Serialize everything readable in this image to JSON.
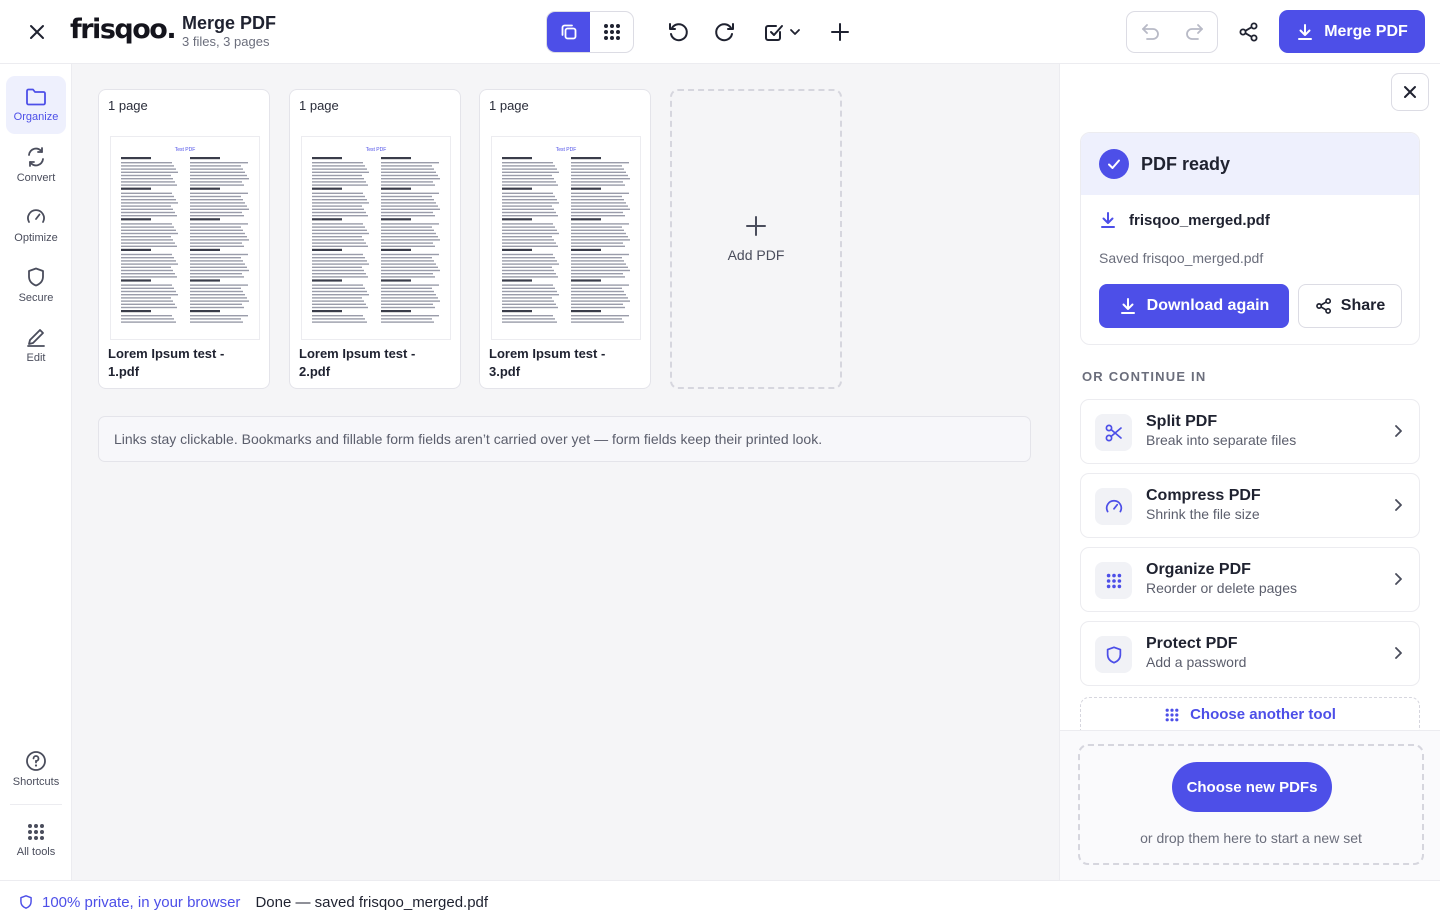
{
  "header": {
    "logo": "frisqoo.",
    "title": "Merge PDF",
    "subtitle": "3 files, 3 pages",
    "merge_button": "Merge PDF"
  },
  "rail": {
    "items": [
      {
        "label": "Organize"
      },
      {
        "label": "Convert"
      },
      {
        "label": "Optimize"
      },
      {
        "label": "Secure"
      },
      {
        "label": "Edit"
      }
    ],
    "shortcuts": "Shortcuts",
    "all_tools": "All tools"
  },
  "files": [
    {
      "pages_label": "1 page",
      "name": "Lorem Ipsum test - 1.pdf",
      "thumb_title": "Test PDF"
    },
    {
      "pages_label": "1 page",
      "name": "Lorem Ipsum test - 2.pdf",
      "thumb_title": "Test PDF"
    },
    {
      "pages_label": "1 page",
      "name": "Lorem Ipsum test - 3.pdf",
      "thumb_title": "Test PDF"
    }
  ],
  "add_pdf": "Add PDF",
  "notice": "Links stay clickable. Bookmarks and fillable form fields aren’t carried over yet — form fields keep their printed look.",
  "panel": {
    "ready_title": "PDF ready",
    "file_name": "frisqoo_merged.pdf",
    "saved_text": "Saved frisqoo_merged.pdf",
    "download_label": "Download again",
    "share_label": "Share",
    "or_continue": "OR CONTINUE IN",
    "tools": [
      {
        "title": "Split PDF",
        "subtitle": "Break into separate files",
        "icon": "scissors-icon"
      },
      {
        "title": "Compress PDF",
        "subtitle": "Shrink the file size",
        "icon": "gauge-icon"
      },
      {
        "title": "Organize PDF",
        "subtitle": "Reorder or delete pages",
        "icon": "grid-dots-icon"
      },
      {
        "title": "Protect PDF",
        "subtitle": "Add a password",
        "icon": "shield-icon"
      }
    ],
    "choose_tool": "Choose another tool",
    "choose_pdfs": "Choose new PDFs",
    "drop_hint": "or drop them here to start a new set"
  },
  "status": {
    "private": "100% private, in your browser",
    "text": "Done — saved frisqoo_merged.pdf"
  },
  "colors": {
    "accent": "#4d4fe8",
    "accent_soft": "#eef0fd",
    "workspace_bg": "#f5f5f7"
  }
}
